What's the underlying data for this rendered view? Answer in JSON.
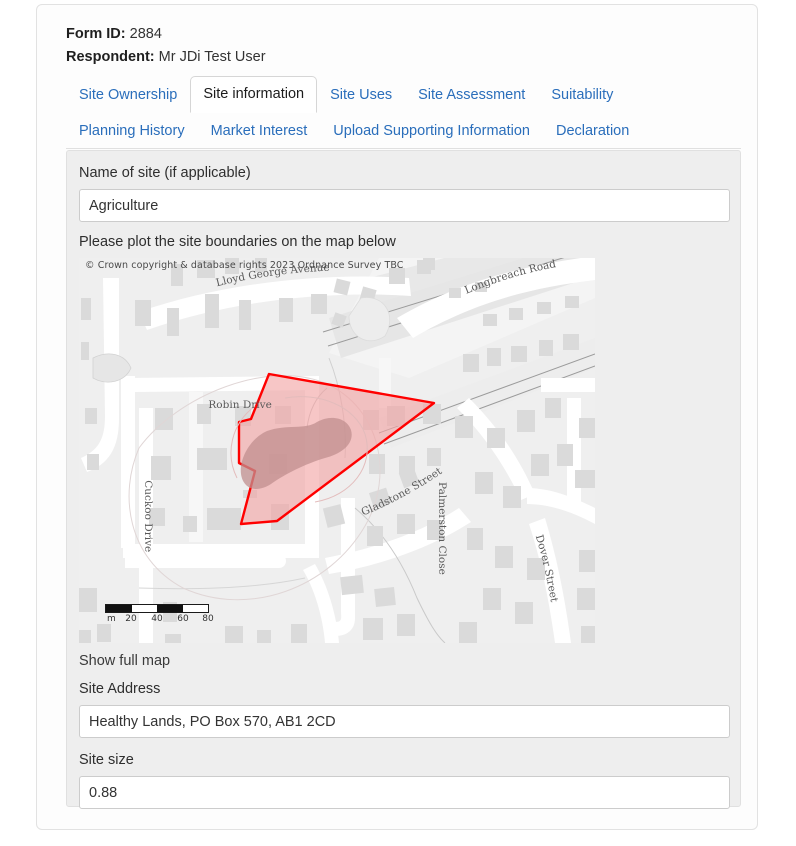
{
  "header": {
    "form_id_label": "Form ID:",
    "form_id_value": "2884",
    "respondent_label": "Respondent:",
    "respondent_value": "Mr JDi Test User"
  },
  "tabs": {
    "row1": [
      {
        "label": "Site Ownership",
        "active": false
      },
      {
        "label": "Site information",
        "active": true
      },
      {
        "label": "Site Uses",
        "active": false
      },
      {
        "label": "Site Assessment",
        "active": false
      },
      {
        "label": "Suitability",
        "active": false
      }
    ],
    "row2": [
      {
        "label": "Planning History",
        "active": false
      },
      {
        "label": "Market Interest",
        "active": false
      },
      {
        "label": "Upload Supporting Information",
        "active": false
      },
      {
        "label": "Declaration",
        "active": false
      }
    ]
  },
  "form": {
    "site_name_label": "Name of site (if applicable)",
    "site_name_value": "Agriculture",
    "site_name_placeholder": "",
    "map_instruction": "Please plot the site boundaries on the map below",
    "show_full_map": "Show full map",
    "site_address_label": "Site Address",
    "site_address_value": "Healthy Lands, PO Box 570, AB1 2CD",
    "site_address_placeholder": "",
    "site_size_label": "Site size",
    "site_size_value": "0.88",
    "site_size_placeholder": ""
  },
  "map": {
    "credit": "© Crown copyright & database rights 2023 Ordnance Survey TBC",
    "streets": [
      "Lloyd George Avenue",
      "Longbreach Road",
      "Robin Drive",
      "Cuckoo Drive",
      "Gladstone Street",
      "Palmerston Close",
      "Dover Street"
    ],
    "scale": {
      "unit": "m",
      "ticks": [
        "20",
        "40",
        "60",
        "80"
      ]
    },
    "boundary_color": "#ff0000",
    "boundary_fill": "#f5a8a8"
  },
  "colors": {
    "link": "#2a6ebb",
    "panel_bg": "#eeeeee",
    "card_bg": "#fdfdfd",
    "boundary": "#ff0000"
  }
}
